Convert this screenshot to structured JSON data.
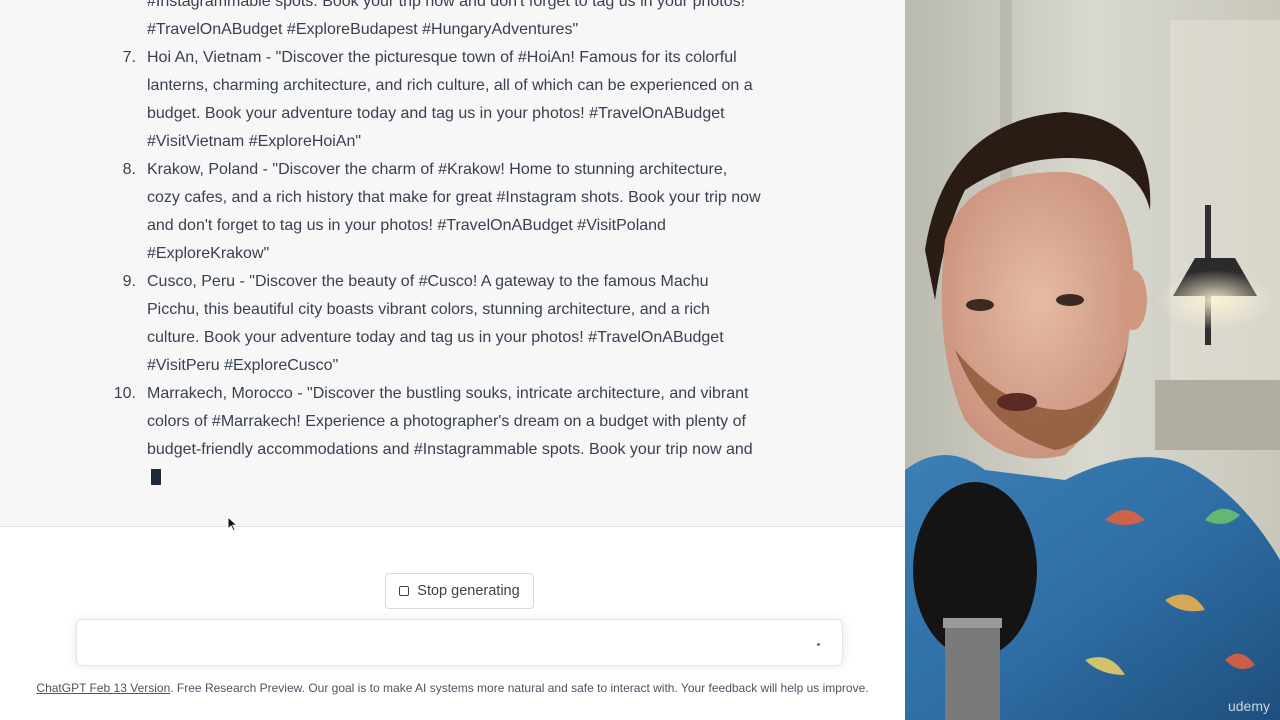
{
  "response": {
    "lines": [
      "#Instagrammable spots. Book your trip now and don't forget to tag us in your photos!",
      "#TravelOnABudget #ExploreBudapest #HungaryAdventures\"",
      "Hoi An, Vietnam - \"Discover the picturesque town of #HoiAn! Famous for its colorful",
      "lanterns, charming architecture, and rich culture, all of which can be experienced on a",
      "budget. Book your adventure today and tag us in your photos! #TravelOnABudget",
      "#VisitVietnam #ExploreHoiAn\"",
      "Krakow, Poland - \"Discover the charm of #Krakow! Home to stunning architecture,",
      "cozy cafes, and a rich history that make for great #Instagram shots. Book your trip now",
      "and don't forget to tag us in your photos! #TravelOnABudget #VisitPoland",
      "#ExploreKrakow\"",
      "Cusco, Peru - \"Discover the beauty of #Cusco! A gateway to the famous Machu",
      "Picchu, this beautiful city boasts vibrant colors, stunning architecture, and a rich",
      "culture. Book your adventure today and tag us in your photos! #TravelOnABudget",
      "#VisitPeru #ExploreCusco\"",
      "Marrakech, Morocco - \"Discover the bustling souks, intricate architecture, and vibrant",
      "colors of #Marrakech! Experience a photographer's dream on a budget with plenty of",
      "budget-friendly accommodations and #Instagrammable spots. Book your trip now and"
    ],
    "numbers": [
      "7.",
      "8.",
      "9.",
      "10."
    ]
  },
  "controls": {
    "stop_label": "Stop generating"
  },
  "footer": {
    "link": "ChatGPT Feb 13 Version",
    "text": ". Free Research Preview. Our goal is to make AI systems more natural and safe to interact with. Your feedback will help us improve."
  },
  "webcam": {
    "watermark": "udemy"
  }
}
